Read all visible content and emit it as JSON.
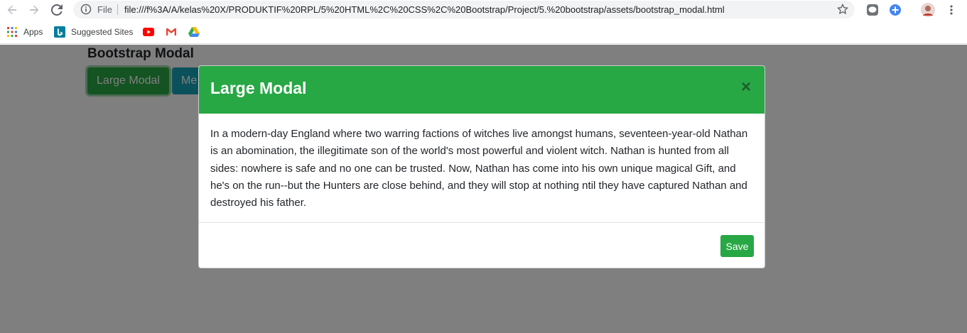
{
  "browser": {
    "file_label": "File",
    "url": "file:///f%3A/A/kelas%20X/PRODUKTIF%20RPL/5%20HTML%2C%20CSS%2C%20Bootstrap/Project/5.%20bootstrap/assets/bootstrap_modal.html",
    "bookmarks": [
      {
        "label": "Apps",
        "icon": "apps-grid-icon"
      },
      {
        "label": "Suggested Sites",
        "icon": "bing-icon"
      },
      {
        "label": "",
        "icon": "youtube-icon"
      },
      {
        "label": "",
        "icon": "gmail-icon"
      },
      {
        "label": "",
        "icon": "google-drive-icon"
      }
    ]
  },
  "page": {
    "title": "Bootstrap Modal",
    "buttons": {
      "large": "Large Modal",
      "medium": "Me"
    }
  },
  "modal": {
    "title": "Large Modal",
    "close_symbol": "×",
    "body": "In a modern-day England where two warring factions of witches live amongst humans, seventeen-year-old Nathan is an abomination, the illegitimate son of the world's most powerful and violent witch. Nathan is hunted from all sides: nowhere is safe and no one can be trusted. Now, Nathan has come into his own unique magical Gift, and he's on the run--but the Hunters are close behind, and they will stop at nothing ntil they have captured Nathan and destroyed his father.",
    "save_label": "Save"
  },
  "colors": {
    "success": "#28a745",
    "info": "#17a2b8",
    "backdrop": "rgba(0,0,0,0.5)"
  }
}
